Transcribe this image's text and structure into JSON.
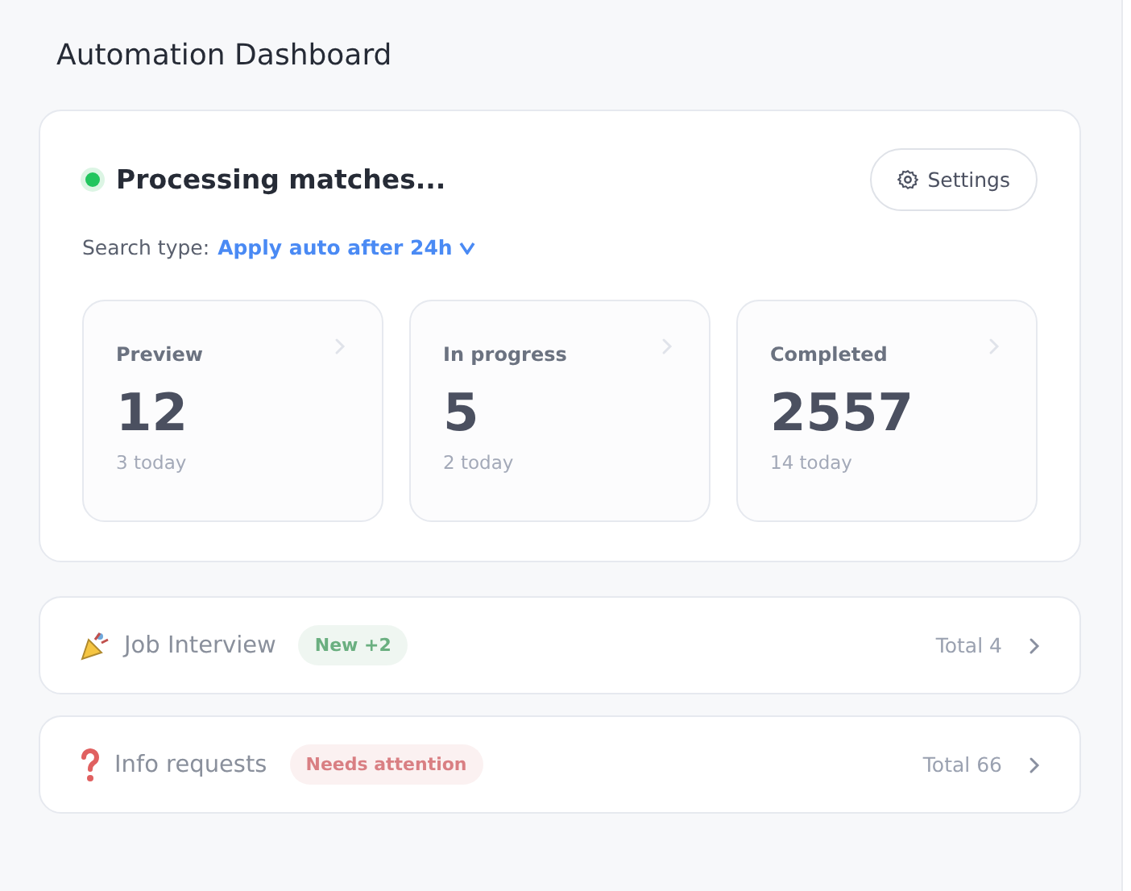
{
  "title": "Automation Dashboard",
  "status": {
    "label": "Processing matches...",
    "color": "#22c55e"
  },
  "settings_button": {
    "label": "Settings"
  },
  "search_type": {
    "label": "Search type:",
    "value": "Apply auto after 24h"
  },
  "stats": [
    {
      "label": "Preview",
      "value": "12",
      "sub": "3 today"
    },
    {
      "label": "In progress",
      "value": "5",
      "sub": "2 today"
    },
    {
      "label": "Completed",
      "value": "2557",
      "sub": "14 today"
    }
  ],
  "rows": [
    {
      "kind": "party",
      "title": "Job Interview",
      "badge": "New +2",
      "color": "#6aaf80",
      "total": "Total 4"
    },
    {
      "kind": "question",
      "title": "Info requests",
      "badge": "Needs attention",
      "color": "#d97f83",
      "total": "Total 66"
    }
  ]
}
